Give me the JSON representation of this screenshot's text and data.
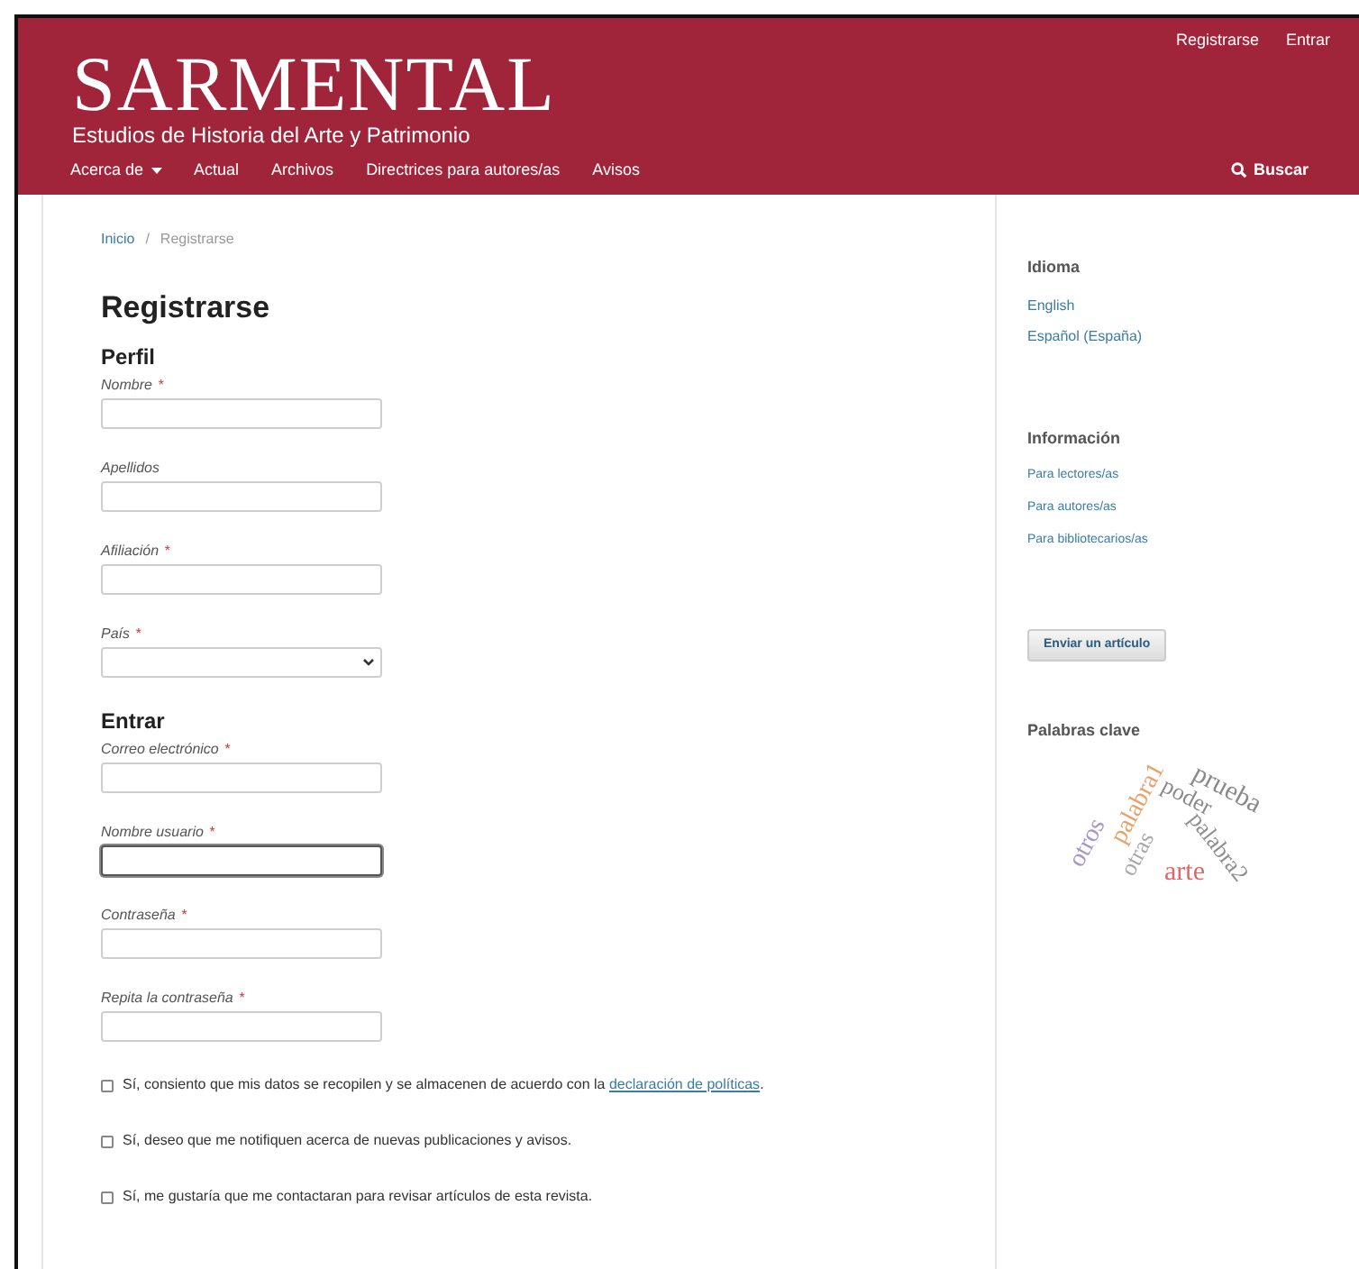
{
  "header": {
    "user_links": [
      "Registrarse",
      "Entrar"
    ],
    "logo_title": "SARMENTAL",
    "logo_subtitle": "Estudios de Historia del Arte y Patrimonio",
    "nav": [
      {
        "label": "Acerca de",
        "dropdown": true
      },
      {
        "label": "Actual",
        "dropdown": false
      },
      {
        "label": "Archivos",
        "dropdown": false
      },
      {
        "label": "Directrices para autores/as",
        "dropdown": false
      },
      {
        "label": "Avisos",
        "dropdown": false
      }
    ],
    "search": "Buscar"
  },
  "breadcrumb": {
    "home": "Inicio",
    "separator": "/",
    "current": "Registrarse"
  },
  "title": "Registrarse",
  "required_marker": "*",
  "sections": [
    {
      "heading": "Perfil",
      "fields": [
        {
          "label": "Nombre",
          "required": true,
          "kind": "text",
          "focused": false
        },
        {
          "label": "Apellidos",
          "required": false,
          "kind": "text",
          "focused": false
        },
        {
          "label": "Afiliación",
          "required": true,
          "kind": "text",
          "focused": false
        },
        {
          "label": "País",
          "required": true,
          "kind": "select",
          "focused": false
        }
      ]
    },
    {
      "heading": "Entrar",
      "fields": [
        {
          "label": "Correo electrónico",
          "required": true,
          "kind": "text",
          "focused": false
        },
        {
          "label": "Nombre usuario",
          "required": true,
          "kind": "text",
          "focused": true
        },
        {
          "label": "Contraseña",
          "required": true,
          "kind": "text",
          "focused": false
        },
        {
          "label": "Repita la contraseña",
          "required": true,
          "kind": "text",
          "focused": false
        }
      ]
    }
  ],
  "consents": [
    {
      "text": "Sí, consiento que mis datos se recopilen y se almacenen de acuerdo con la",
      "link": "declaración de políticas",
      "after": ".",
      "checked": false
    },
    {
      "text": "Sí, deseo que me notifiquen acerca de nuevas publicaciones y avisos.",
      "checked": false
    },
    {
      "text": "Sí, me gustaría que me contactaran para revisar artículos de esta revista.",
      "checked": false
    }
  ],
  "sidebar": {
    "language": {
      "heading": "Idioma",
      "items": [
        "English",
        "Español (España)"
      ]
    },
    "info": {
      "heading": "Información",
      "items": [
        "Para lectores/as",
        "Para autores/as",
        "Para bibliotecarios/as"
      ]
    },
    "submit_button": "Enviar un artículo",
    "keywords": {
      "heading": "Palabras clave",
      "words": [
        {
          "text": "prueba",
          "color": "#8a8a8a"
        },
        {
          "text": "poder",
          "color": "#8a8a8a"
        },
        {
          "text": "palabra1",
          "color": "#e9a066"
        },
        {
          "text": "palabra2",
          "color": "#8f8f8f"
        },
        {
          "text": "otros",
          "color": "#a596cc"
        },
        {
          "text": "otras",
          "color": "#a8a8a8"
        },
        {
          "text": "arte",
          "color": "#e06666"
        }
      ]
    }
  }
}
